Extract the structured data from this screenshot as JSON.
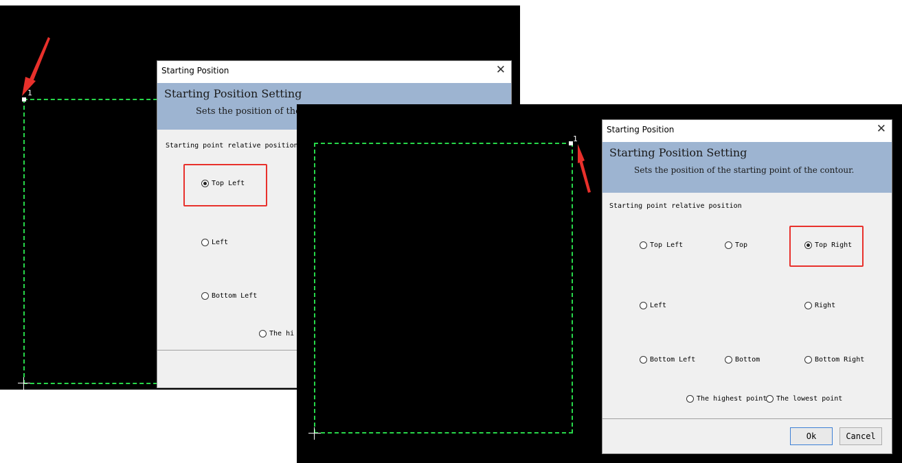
{
  "screenshot_left": {
    "point_label": "1",
    "dialog": {
      "title": "Starting Position",
      "close_glyph": "✕",
      "heading": "Starting Position Setting",
      "subtitle": "Sets the position of the",
      "section_label": "Starting point relative position",
      "options": [
        {
          "label": "Top Left",
          "checked": true
        },
        {
          "label": "Left",
          "checked": false
        },
        {
          "label": "Bottom Left",
          "checked": false
        },
        {
          "label": "The hi",
          "checked": false
        }
      ]
    }
  },
  "screenshot_right": {
    "point_label": "1",
    "dialog": {
      "title": "Starting Position",
      "close_glyph": "✕",
      "heading": "Starting Position Setting",
      "subtitle": "Sets the position of the starting point of the contour.",
      "section_label": "Starting point relative position",
      "options": {
        "top_left": "Top Left",
        "top": "Top",
        "top_right": "Top Right",
        "left": "Left",
        "right": "Right",
        "bottom_left": "Bottom Left",
        "bottom": "Bottom",
        "bottom_right": "Bottom Right",
        "highest": "The highest point",
        "lowest": "The lowest point"
      },
      "selected": "top_right",
      "ok_label": "Ok",
      "cancel_label": "Cancel"
    }
  },
  "colors": {
    "canvas": "#000000",
    "contour": "#27d84a",
    "banner": "#9db4d1",
    "highlight": "#e8302b",
    "arrow": "#e8302b"
  },
  "icons": [
    "close-icon",
    "red-arrow-icon",
    "radio-icon",
    "start-point-marker",
    "origin-cross-icon"
  ]
}
